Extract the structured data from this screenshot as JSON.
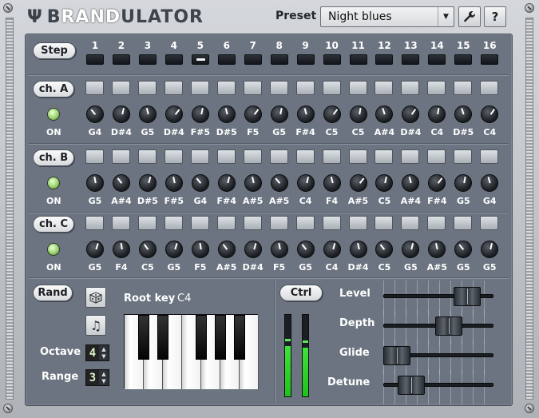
{
  "app": {
    "logo_icon": "Ψ",
    "logo_pre": "B",
    "logo_hl": "RAND",
    "logo_post": "ULATOR"
  },
  "header": {
    "preset_label": "Preset",
    "preset_value": "Night blues",
    "wrench_icon": "wrench-icon",
    "help_label": "?"
  },
  "step": {
    "label": "Step",
    "numbers": [
      "1",
      "2",
      "3",
      "4",
      "5",
      "6",
      "7",
      "8",
      "9",
      "10",
      "11",
      "12",
      "13",
      "14",
      "15",
      "16"
    ],
    "active_index": 4
  },
  "channels": [
    {
      "label": "ch. A",
      "on_label": "ON",
      "notes": [
        "G4",
        "D#4",
        "G5",
        "D#4",
        "F#5",
        "D#5",
        "F5",
        "G5",
        "F#4",
        "C5",
        "C5",
        "A#4",
        "D#4",
        "C4",
        "D#5",
        "C4"
      ]
    },
    {
      "label": "ch. B",
      "on_label": "ON",
      "notes": [
        "G5",
        "A#4",
        "D#5",
        "F#5",
        "G4",
        "F#4",
        "A#5",
        "A#5",
        "C4",
        "F4",
        "A#5",
        "C5",
        "A#4",
        "F#4",
        "G5",
        "G4"
      ]
    },
    {
      "label": "ch. C",
      "on_label": "ON",
      "notes": [
        "G5",
        "F4",
        "C5",
        "G5",
        "F5",
        "A#5",
        "D#4",
        "F5",
        "G5",
        "C4",
        "D#4",
        "C5",
        "G5",
        "A#5",
        "G5",
        "G5"
      ]
    }
  ],
  "rand": {
    "label": "Rand",
    "dice_icon": "dice-icon",
    "note_icon": "music-note-icon",
    "root_key_label": "Root key",
    "root_key_value": "C4",
    "octave_label": "Octave",
    "octave_value": "4",
    "range_label": "Range",
    "range_value": "3"
  },
  "ctrl": {
    "label": "Ctrl",
    "meter_levels": [
      0.62,
      0.6
    ],
    "sliders": [
      {
        "label": "Level",
        "value": 0.78
      },
      {
        "label": "Depth",
        "value": 0.59
      },
      {
        "label": "Glide",
        "value": 0.05
      },
      {
        "label": "Detune",
        "value": 0.2
      }
    ]
  }
}
